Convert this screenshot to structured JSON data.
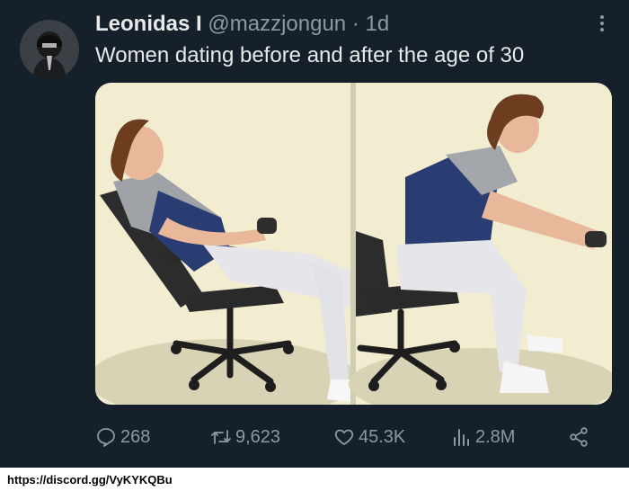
{
  "tweet": {
    "author": {
      "display_name": "Leonidas I",
      "handle": "@mazzjongun",
      "separator": "·",
      "time": "1d"
    },
    "text": "Women dating before and after the age of 30",
    "media": {
      "left_panel": "relaxed-leaning-back-gamer",
      "right_panel": "leaning-forward-gamer"
    },
    "actions": {
      "replies": "268",
      "retweets": "9,623",
      "likes": "45.3K",
      "views": "2.8M"
    }
  },
  "footer": {
    "link": "https://discord.gg/VyKYKQBu"
  },
  "icons": {
    "more": "more-icon",
    "reply": "reply-icon",
    "retweet": "retweet-icon",
    "like": "heart-icon",
    "views": "views-icon",
    "share": "share-icon"
  },
  "colors": {
    "background": "#15202b",
    "primary_text": "#e7e9ea",
    "secondary_text": "#8b98a5"
  }
}
